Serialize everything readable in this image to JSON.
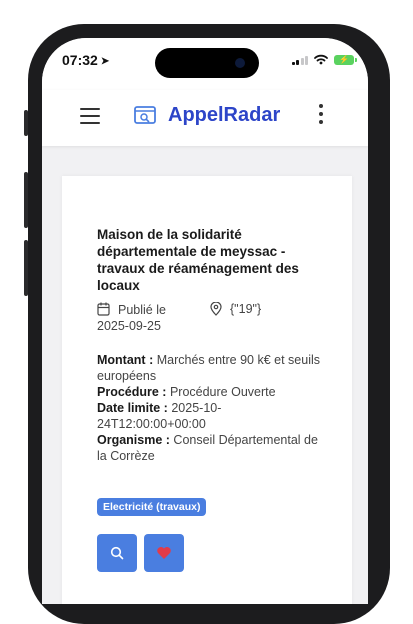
{
  "status_bar": {
    "time": "07:32"
  },
  "header": {
    "title": "AppelRadar",
    "menu_icon": "hamburger-menu-icon",
    "more_icon": "more-vertical-icon"
  },
  "card": {
    "title": "Maison de la solidarité départementale de meyssac - travaux de réaménagement des locaux",
    "published_label": "Publié le",
    "published_date": "2025-09-25",
    "location": "{\"19\"}",
    "montant_label": "Montant :",
    "montant_value": "Marchés entre 90 k€ et seuils européens",
    "procedure_label": "Procédure :",
    "procedure_value": "Procédure Ouverte",
    "date_limite_label": "Date limite :",
    "date_limite_value": "2025-10-24T12:00:00+00:00",
    "organisme_label": "Organisme :",
    "organisme_value": "Conseil Départemental de la Corrèze",
    "tag": "Electricité (travaux)"
  },
  "colors": {
    "brand": "#2d45c8",
    "accent": "#4a7ee0",
    "heart": "#e23b4a"
  }
}
